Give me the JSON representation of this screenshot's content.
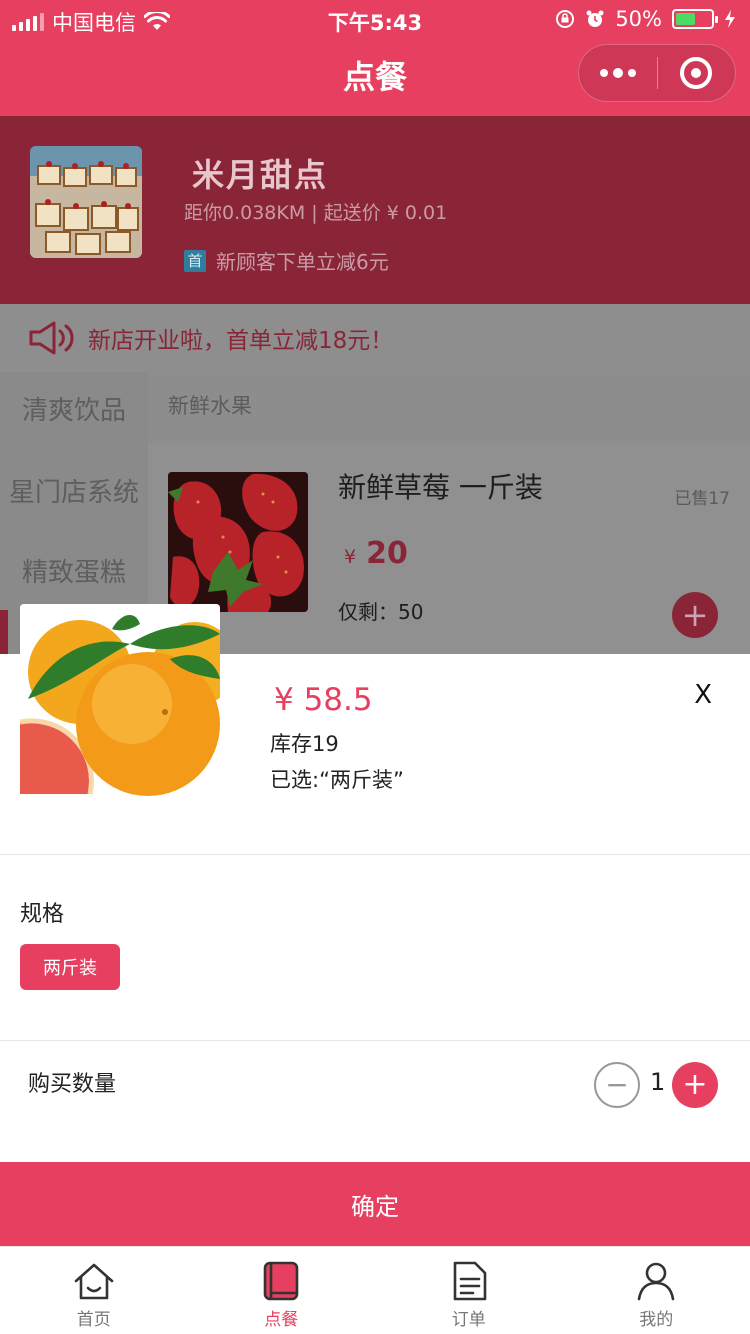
{
  "status": {
    "carrier": "中国电信",
    "time": "下午5:43",
    "battery": "50%",
    "battery_level": 0.5
  },
  "nav": {
    "title": "点餐"
  },
  "shop": {
    "name": "米月甜点",
    "distance": "距你0.038KM | 起送价 ¥ 0.01",
    "promo_badge": "首",
    "promo_text": "新顾客下单立减6元"
  },
  "notice": {
    "text": "新店开业啦，首单立减18元！"
  },
  "menu": {
    "categories": [
      "清爽饮品",
      "星门店系统",
      "精致蛋糕"
    ],
    "section": "新鲜水果",
    "product": {
      "name": "新鲜草莓 一斤装",
      "sold": "已售17",
      "currency": "¥",
      "price": "20",
      "stock": "仅剩：50",
      "add": "+"
    }
  },
  "sheet": {
    "price": "¥ 58.5",
    "stock": "库存19",
    "selected": "已选:“两斤装”",
    "close": "X",
    "spec_label": "规格",
    "spec_option": "两斤装",
    "qty_label": "购买数量",
    "minus": "−",
    "qty": "1",
    "plus": "+",
    "confirm": "确定"
  },
  "tabbar": [
    {
      "label": "首页",
      "icon": "home-icon"
    },
    {
      "label": "点餐",
      "icon": "menu-book-icon",
      "active": true
    },
    {
      "label": "订单",
      "icon": "order-icon"
    },
    {
      "label": "我的",
      "icon": "user-icon"
    }
  ],
  "colors": {
    "brand": "#e63f60",
    "dimmed_brand": "#8a2538",
    "overlay_gray": "#8c8c8c"
  }
}
